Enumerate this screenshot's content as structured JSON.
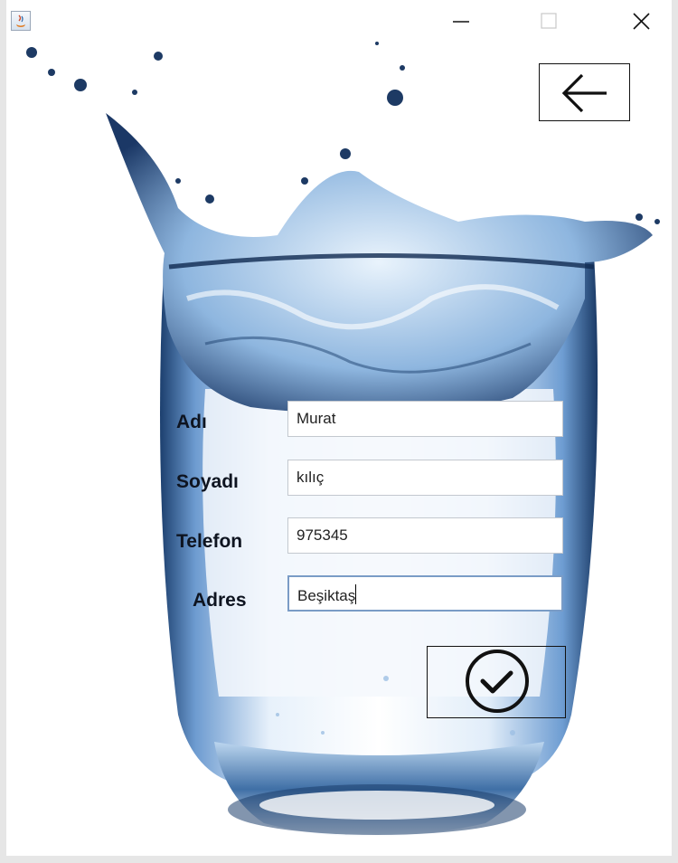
{
  "window": {
    "controls": {
      "minimize_icon": "minimize-icon",
      "maximize_icon": "maximize-icon",
      "close_icon": "close-icon"
    }
  },
  "toolbar": {
    "back_icon": "arrow-left-icon"
  },
  "form": {
    "fields": [
      {
        "label": "Adı",
        "value": "Murat"
      },
      {
        "label": "Soyadı",
        "value": "kılıç"
      },
      {
        "label": "Telefon",
        "value": "975345"
      },
      {
        "label": "Adres",
        "value": "Beşiktaş"
      }
    ],
    "confirm_icon": "check-circle-icon"
  },
  "colors": {
    "water": "#9fc3e6",
    "water_dark": "#1d3f6e",
    "border": "#111111"
  }
}
